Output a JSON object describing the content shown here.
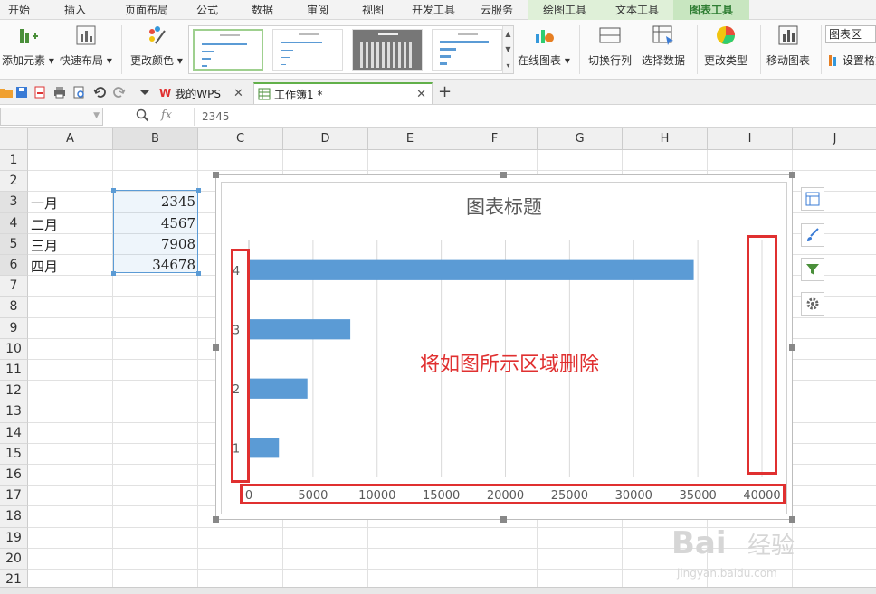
{
  "ribbon_tabs": [
    {
      "label": "开始",
      "w": 42
    },
    {
      "label": "插入",
      "w": 82
    },
    {
      "label": "页面布局",
      "w": 76
    },
    {
      "label": "公式",
      "w": 58
    },
    {
      "label": "数据",
      "w": 64
    },
    {
      "label": "审阅",
      "w": 58
    },
    {
      "label": "视图",
      "w": 64
    },
    {
      "label": "开发工具",
      "w": 70
    },
    {
      "label": "云服务",
      "w": 70
    },
    {
      "label": "绘图工具",
      "w": 80
    },
    {
      "label": "文本工具",
      "w": 80
    },
    {
      "label": "图表工具",
      "w": 84
    }
  ],
  "ribbon": {
    "add_element": "添加元素",
    "quick_layout": "快速布局",
    "change_color": "更改颜色",
    "online_chart": "在线图表",
    "switch_row_col": "切换行列",
    "select_data": "选择数据",
    "change_type": "更改类型",
    "move_chart": "移动图表",
    "chart_area_combo": "图表区",
    "set_format": "设置格式"
  },
  "doc_tabs": {
    "wps": "我的WPS",
    "workbook": "工作簿1 *"
  },
  "formula_bar": {
    "fx": "fx",
    "value": "2345"
  },
  "columns": [
    "A",
    "B",
    "C",
    "D",
    "E",
    "F",
    "G",
    "H",
    "I",
    "J"
  ],
  "rows": [
    "1",
    "2",
    "3",
    "4",
    "5",
    "6",
    "7",
    "8",
    "9",
    "10",
    "11",
    "12",
    "13",
    "14",
    "15",
    "16",
    "17",
    "18",
    "19",
    "20",
    "21"
  ],
  "cells": {
    "a3": "一月",
    "a4": "二月",
    "a5": "三月",
    "a6": "四月",
    "b3": "2345",
    "b4": "4567",
    "b5": "7908",
    "b6": "34678"
  },
  "annotation": "将如图所示区域删除",
  "colors": {
    "bar": "#5b9bd5",
    "annotation": "#e03030",
    "active_tab": "#2e7d32"
  },
  "chart_data": {
    "type": "bar",
    "orientation": "horizontal",
    "title": "图表标题",
    "categories": [
      "1",
      "2",
      "3",
      "4"
    ],
    "values": [
      2345,
      4567,
      7908,
      34678
    ],
    "xlim": [
      0,
      40000
    ],
    "xticks": [
      "0",
      "5000",
      "10000",
      "15000",
      "20000",
      "25000",
      "30000",
      "35000",
      "40000"
    ],
    "grid": true,
    "legend": "none"
  }
}
